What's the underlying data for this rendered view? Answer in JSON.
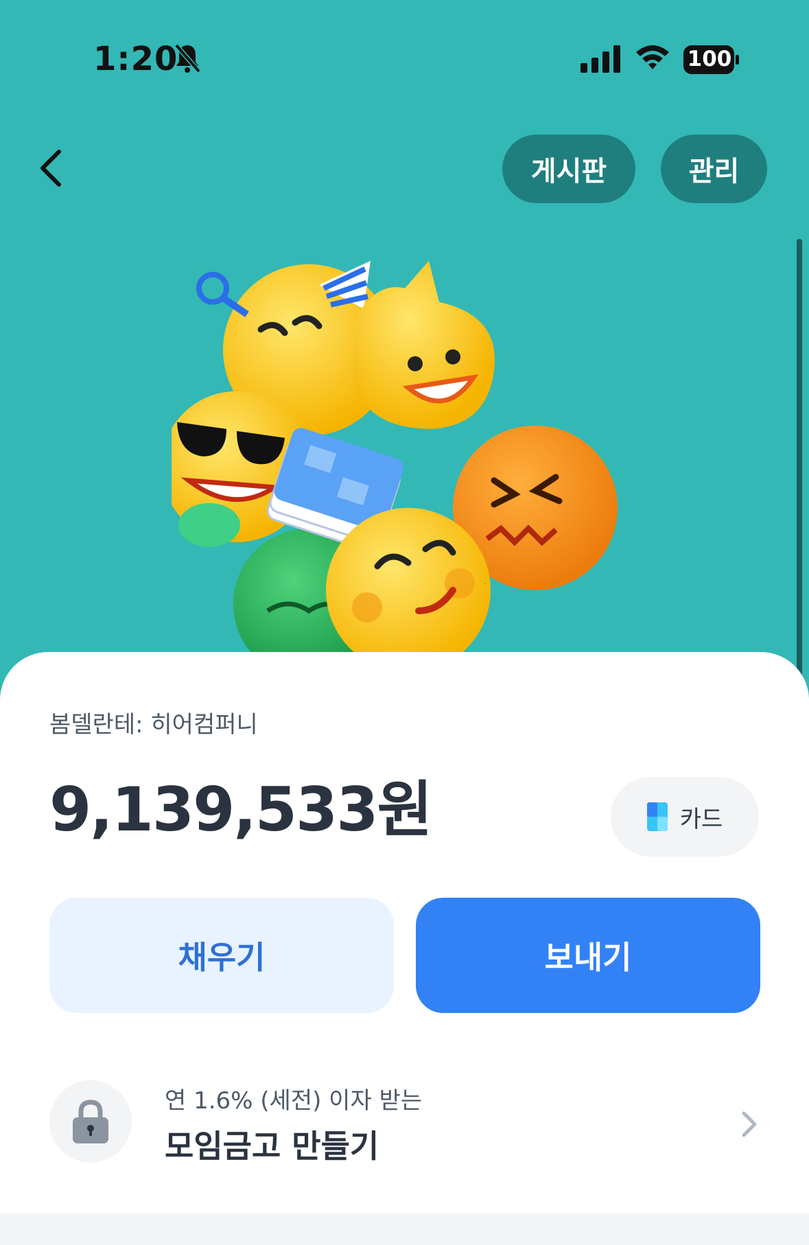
{
  "status_bar": {
    "time": "1:20",
    "battery": "100",
    "icons": [
      "bell-slash-icon",
      "signal-icon",
      "wifi-icon",
      "battery-icon"
    ]
  },
  "header": {
    "board_label": "게시판",
    "manage_label": "관리",
    "back_icon": "chevron-left-icon"
  },
  "hero": {
    "image": "emoji-group-illustration"
  },
  "account": {
    "name": "봄델란테: 히어컴퍼니",
    "balance": "9,139,533원",
    "card_label": "카드"
  },
  "actions": {
    "fill_label": "채우기",
    "send_label": "보내기"
  },
  "savings": {
    "subtitle": "연 1.6% (세전) 이자 받는",
    "title": "모임금고 만들기"
  },
  "colors": {
    "background": "#33b8b6",
    "pill": "#1f7f7e",
    "primary": "#3282f6",
    "primary_light": "#e8f3ff",
    "text_dark": "#2b3340"
  }
}
